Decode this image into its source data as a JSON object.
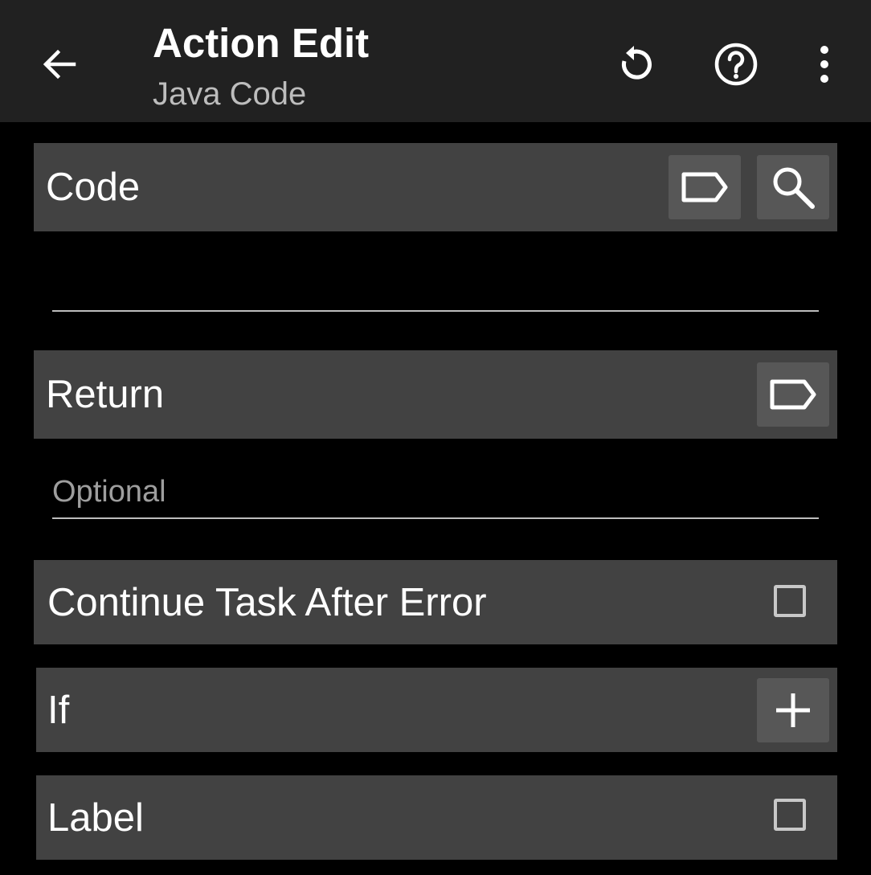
{
  "appbar": {
    "title": "Action Edit",
    "subtitle": "Java Code",
    "back_icon": "arrow-left-icon",
    "actions": [
      "undo-icon",
      "help-icon",
      "more-vert-icon"
    ]
  },
  "sections": {
    "code": {
      "label": "Code",
      "value": "",
      "placeholder": "",
      "buttons": [
        "tag-icon",
        "search-icon"
      ]
    },
    "return": {
      "label": "Return",
      "value": "",
      "placeholder": "Optional",
      "buttons": [
        "tag-icon"
      ]
    },
    "continue_after_error": {
      "label": "Continue Task After Error",
      "checked": false
    },
    "if": {
      "label": "If",
      "button": "plus-icon"
    },
    "label": {
      "label": "Label",
      "checked": false
    }
  },
  "colors": {
    "appbar_bg": "#212121",
    "page_bg": "#000000",
    "section_bg": "#424242",
    "button_bg": "#575757",
    "text": "#ffffff",
    "secondary_text": "#bdbdbd"
  }
}
